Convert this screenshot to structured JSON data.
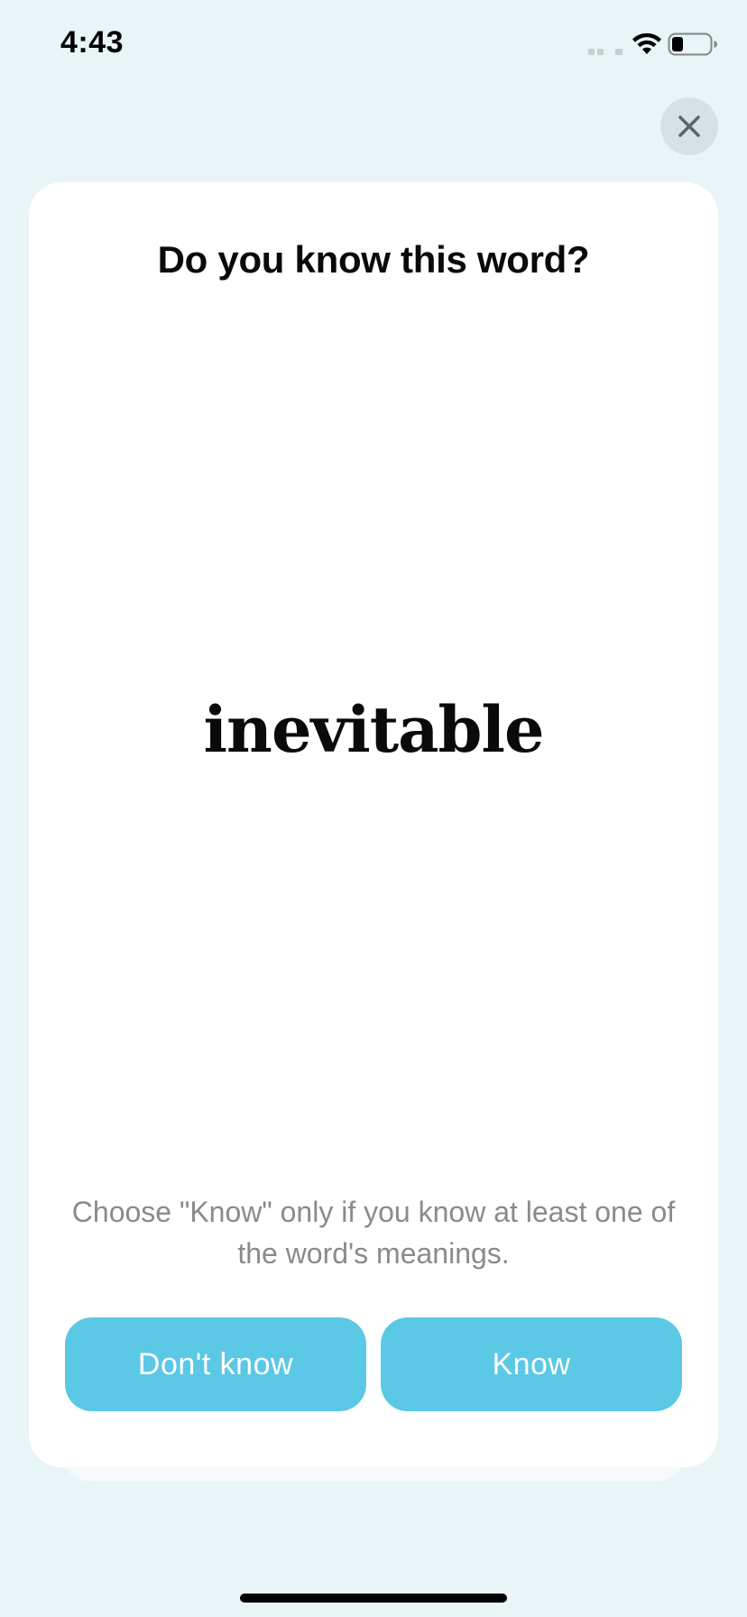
{
  "status_bar": {
    "time": "4:43"
  },
  "icons": {
    "close": "close-icon",
    "wifi": "wifi-icon",
    "battery": "battery-icon",
    "signal": "signal-icon"
  },
  "card": {
    "title": "Do you know this word?",
    "word": "inevitable",
    "hint": "Choose \"Know\" only if you know at least one of the word's meanings.",
    "dont_know_label": "Don't know",
    "know_label": "Know"
  },
  "colors": {
    "background": "#E8F4F6",
    "card": "#FFFFFF",
    "button": "#5BC8E6",
    "hint_text": "#8A8A8E"
  }
}
